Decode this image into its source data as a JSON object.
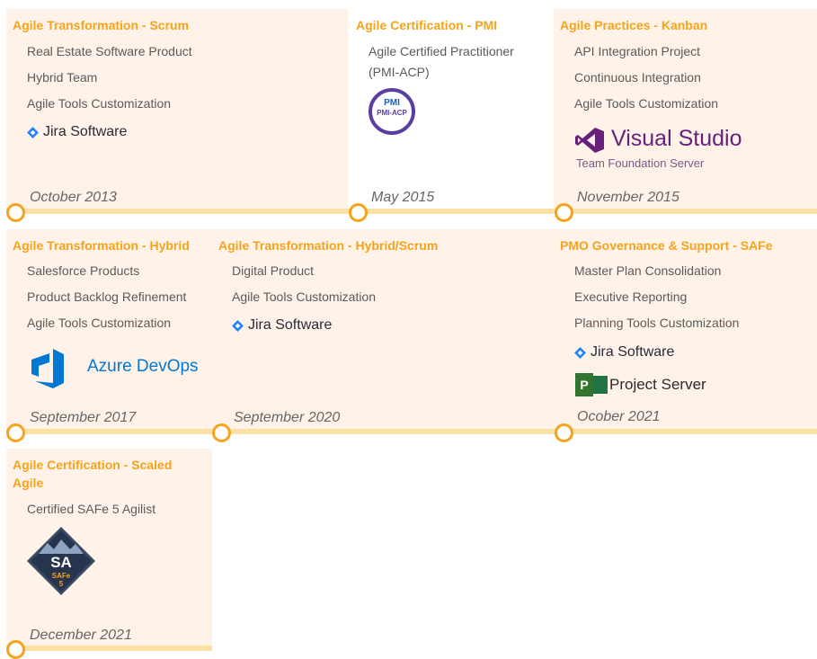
{
  "cards": [
    {
      "title": "Agile Transformation - Scrum",
      "items": [
        "Real Estate Software Product",
        "Hybrid Team",
        "Agile Tools Customization"
      ],
      "date": "October 2013"
    },
    {
      "title": "Agile Certification - PMI",
      "items": [
        "Agile Certified Practitioner",
        "(PMI-ACP)"
      ],
      "date": "May 2015"
    },
    {
      "title": "Agile Practices - Kanban",
      "items": [
        "API Integration Project",
        "Continuous Integration",
        "Agile Tools Customization"
      ],
      "date": "November 2015"
    },
    {
      "title": "Agile Transformation - Hybrid",
      "items": [
        "Salesforce Products",
        "Product Backlog Refinement",
        "Agile Tools Customization"
      ],
      "date": "September 2017"
    },
    {
      "title": "Agile Transformation - Hybrid/Scrum",
      "items": [
        "Digital Product",
        "Agile Tools Customization"
      ],
      "date": "September 2020"
    },
    {
      "title": "PMO Governance & Support - SAFe",
      "items": [
        "Master Plan Consolidation",
        "Executive Reporting",
        "Planning Tools Customization"
      ],
      "date": "Ocober 2021"
    },
    {
      "title": "Agile Certification - Scaled Agile",
      "items": [
        "Certified SAFe 5 Agilist"
      ],
      "date": "December 2021"
    }
  ],
  "logos": {
    "jira": "Jira Software",
    "pmi_top": "PMI",
    "pmi_bottom": "PMI-ACP",
    "vs_title": "Visual Studio",
    "vs_sub": "Team Foundation Server",
    "azure": "Azure DevOps",
    "project_server": "Project Server",
    "project_letter": "P",
    "safe_sa": "SA",
    "safe_brand": "SAFe",
    "safe_num": "5"
  },
  "colors": {
    "accent": "#f5a31a",
    "card_bg": "#fff3e9",
    "timeline": "#fde0a6",
    "text": "#5a5a5a"
  }
}
